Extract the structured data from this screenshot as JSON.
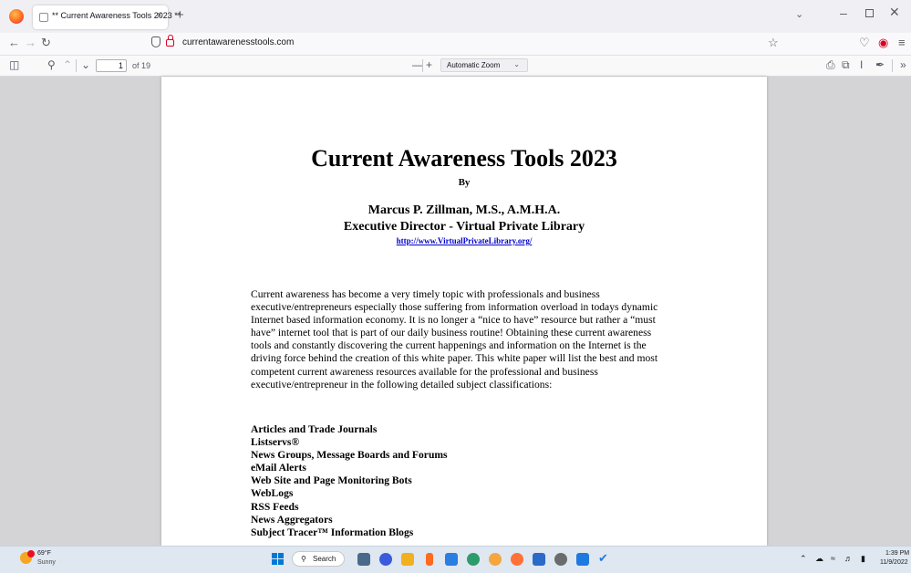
{
  "browser": {
    "tab_title": "** Current Awareness Tools 2023 **",
    "tab_close": "×",
    "new_tab": "+",
    "url": "currentawarenesstools.com",
    "window_min": "–",
    "window_close": "✕"
  },
  "pdf_toolbar": {
    "page_number": "1",
    "page_count": "of 19",
    "zoom_out": "—",
    "zoom_in": "+",
    "zoom_value": "Automatic Zoom"
  },
  "document": {
    "title": "Current Awareness Tools 2023",
    "by": "By",
    "author": "Marcus P. Zillman, M.S., A.M.H.A.",
    "role": "Executive Director - Virtual Private Library",
    "link": "http://www.VirtualPrivateLibrary.org/",
    "body": "Current awareness has become a very timely topic with professionals and business executive/entrepreneurs especially those suffering from information overload in todays dynamic Internet based information economy. It is no longer a “nice to have” resource but rather a “must have” internet tool that is part of our daily business routine! Obtaining these current awareness tools and constantly discovering the current happenings and information on the Internet is the driving force behind the creation of this white paper. This white paper will list the best and most competent current awareness resources available for the professional and business executive/entrepreneur in the following detailed subject classifications:",
    "topics": [
      "Articles and Trade Journals",
      "Listservs®",
      "News Groups, Message Boards and Forums",
      "eMail Alerts",
      "Web Site and Page Monitoring Bots",
      "WebLogs",
      "RSS Feeds",
      "News Aggregators",
      "Subject Tracer™ Information Blogs"
    ]
  },
  "taskbar": {
    "weather_temp": "69°F",
    "weather_desc": "Sunny",
    "search_label": "Search",
    "time": "1:39 PM",
    "date": "11/9/2022"
  }
}
